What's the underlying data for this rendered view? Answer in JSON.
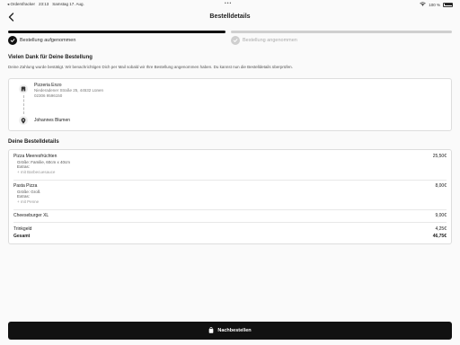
{
  "status_bar": {
    "carrier": "◂ Ordersfracker",
    "time": "23:13",
    "date": "Samstag 17. Aug.",
    "dots": "•••",
    "battery": "100 %",
    "battery_level": 1.0
  },
  "nav": {
    "title": "Bestelldetails"
  },
  "progress": {
    "step1_label": "Bestellung aufgenommen",
    "step2_label": "Bestellung angenommen"
  },
  "thanks": {
    "title": "Vielen Dank für Deine Bestellung",
    "text": "Deine Zahlung wurde bestätigt. Wir benachrichtigen Dich per Mail sobald wir Ihre Bestellung angenommen haben. Du kannst nun die Bestelldetails überprüfen."
  },
  "restaurant": {
    "name": "Pizzeria Enzo",
    "address": "Niederadener Straße 25, 44532 Lünen",
    "phone": "02306 9596150"
  },
  "customer": {
    "name": "Johannes Blumen"
  },
  "details": {
    "title": "Deine Bestelldetails",
    "items": [
      {
        "name": "Pizza Meeresfrüchten",
        "price": "25,50€",
        "size_label": "Größe:",
        "size_value": "Familie, 60cm x 40cm",
        "extras_label": "Extras:",
        "extras": "+ mit Barbecuesauce"
      },
      {
        "name": "Pasta Pizza",
        "price": "8,00€",
        "size_label": "Größe:",
        "size_value": "Groß",
        "extras_label": "Extras:",
        "extras": "+ mit Penne"
      },
      {
        "name": "Cheeseburger XL",
        "price": "9,00€"
      }
    ],
    "tip_label": "Trinkgeld",
    "tip_value": "4,25€",
    "total_label": "Gesamt",
    "total_value": "46,75€"
  },
  "reorder": {
    "label": "Nachbestellen"
  }
}
